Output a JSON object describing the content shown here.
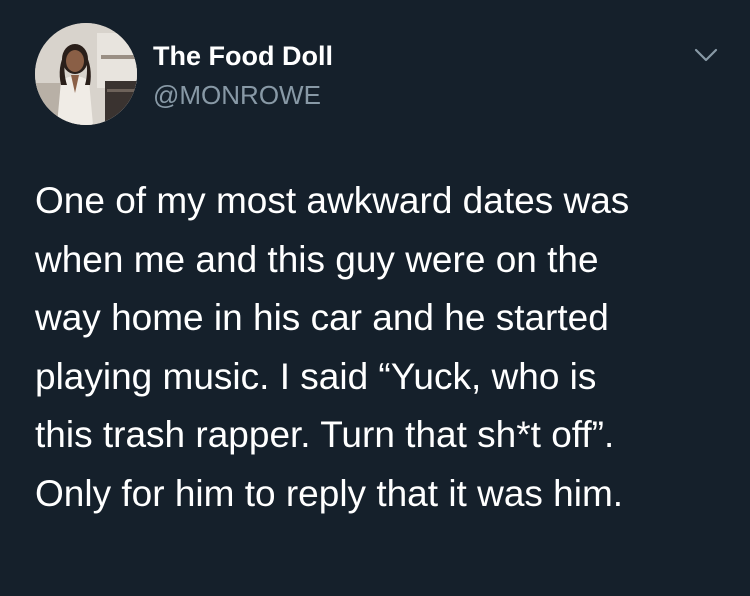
{
  "user": {
    "display_name": "The Food Doll",
    "handle": "@MONROWE",
    "avatar_icon": "profile-photo",
    "menu_icon": "chevron-down-icon"
  },
  "tweet": {
    "text": "One of my most awkward dates was\nwhen me and this guy were on the\nway home in his car and he started\nplaying music. I said “Yuck, who is\nthis trash rapper. Turn that sh*t off”.\nOnly for him to reply that it was him."
  },
  "colors": {
    "background": "#15202b",
    "primary_text": "#ffffff",
    "secondary_text": "#8899a6"
  }
}
